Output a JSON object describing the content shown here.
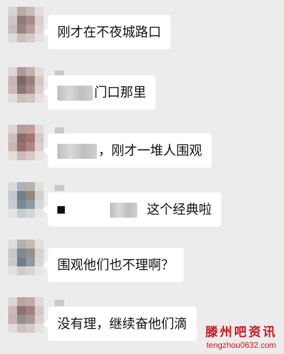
{
  "messages": [
    {
      "text": "刚才在不夜城路口",
      "prefix_blur": false
    },
    {
      "text": "门口那里",
      "prefix_blur": true
    },
    {
      "text": "，刚才一堆人围观",
      "prefix_blur": true
    },
    {
      "text": "这个经典啦",
      "prefix_blur": true
    },
    {
      "text": "围观他们也不理啊？",
      "prefix_blur": false
    },
    {
      "text": "没有理，继续奋他们滴",
      "prefix_blur": false
    }
  ],
  "watermark": {
    "title": "滕州吧资讯",
    "url": "tengzhou0632.com",
    "color": "#d0141c"
  },
  "colors": {
    "background": "#ececec",
    "bubble": "#ffffff"
  }
}
